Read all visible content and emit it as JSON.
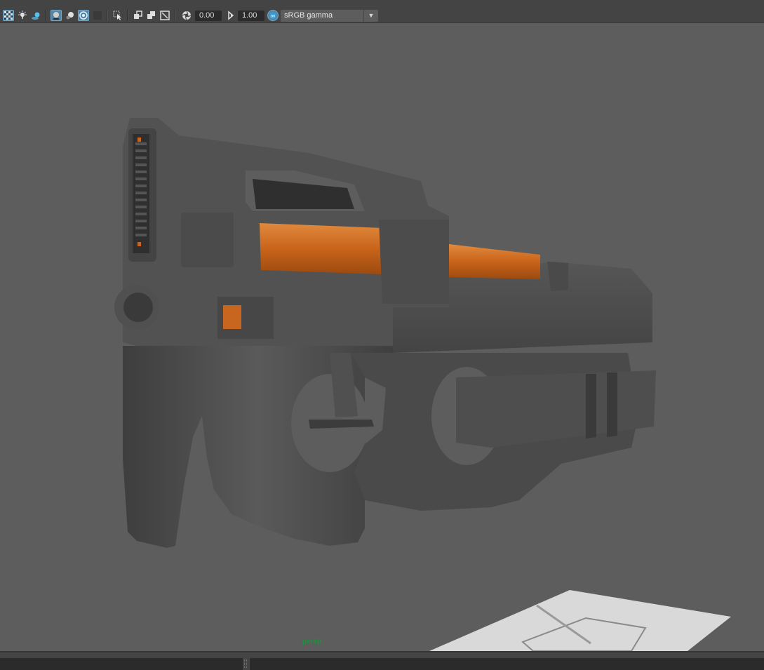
{
  "toolbar": {
    "buttons": [
      {
        "name": "xray-toggle",
        "icon": "checker-icon",
        "active": true
      },
      {
        "name": "lighting",
        "icon": "light-bulb-icon",
        "active": false
      },
      {
        "name": "shadows",
        "icon": "shadow-icon",
        "active": false
      },
      {
        "name": "ambient-occlusion",
        "icon": "ao-icon",
        "active": true
      },
      {
        "name": "motion-blur",
        "icon": "sphere-icon",
        "active": false
      },
      {
        "name": "anti-aliasing",
        "icon": "aa-icon",
        "active": true
      },
      {
        "name": "hud",
        "icon": "hud-icon",
        "active": false
      },
      {
        "name": "select",
        "icon": "cursor-icon",
        "active": false
      },
      {
        "name": "isolate",
        "icon": "isolate-icon",
        "active": false
      },
      {
        "name": "camera-gate",
        "icon": "gate-icon",
        "active": false
      },
      {
        "name": "resolution-gate",
        "icon": "resolution-icon",
        "active": false
      },
      {
        "name": "exposure",
        "icon": "aperture-icon",
        "active": false
      },
      {
        "name": "gamma",
        "icon": "gamma-icon",
        "active": false
      },
      {
        "name": "color-management",
        "icon": "colormanagement-icon",
        "active": true
      }
    ],
    "exposure_value": "0.00",
    "gamma_value": "1.00",
    "color_space": "sRGB gamma"
  },
  "viewport": {
    "camera_label": "persp",
    "background_color": "#5d5d5d",
    "model_color": "#4c4c4c",
    "accent_color": "#c8651e"
  }
}
